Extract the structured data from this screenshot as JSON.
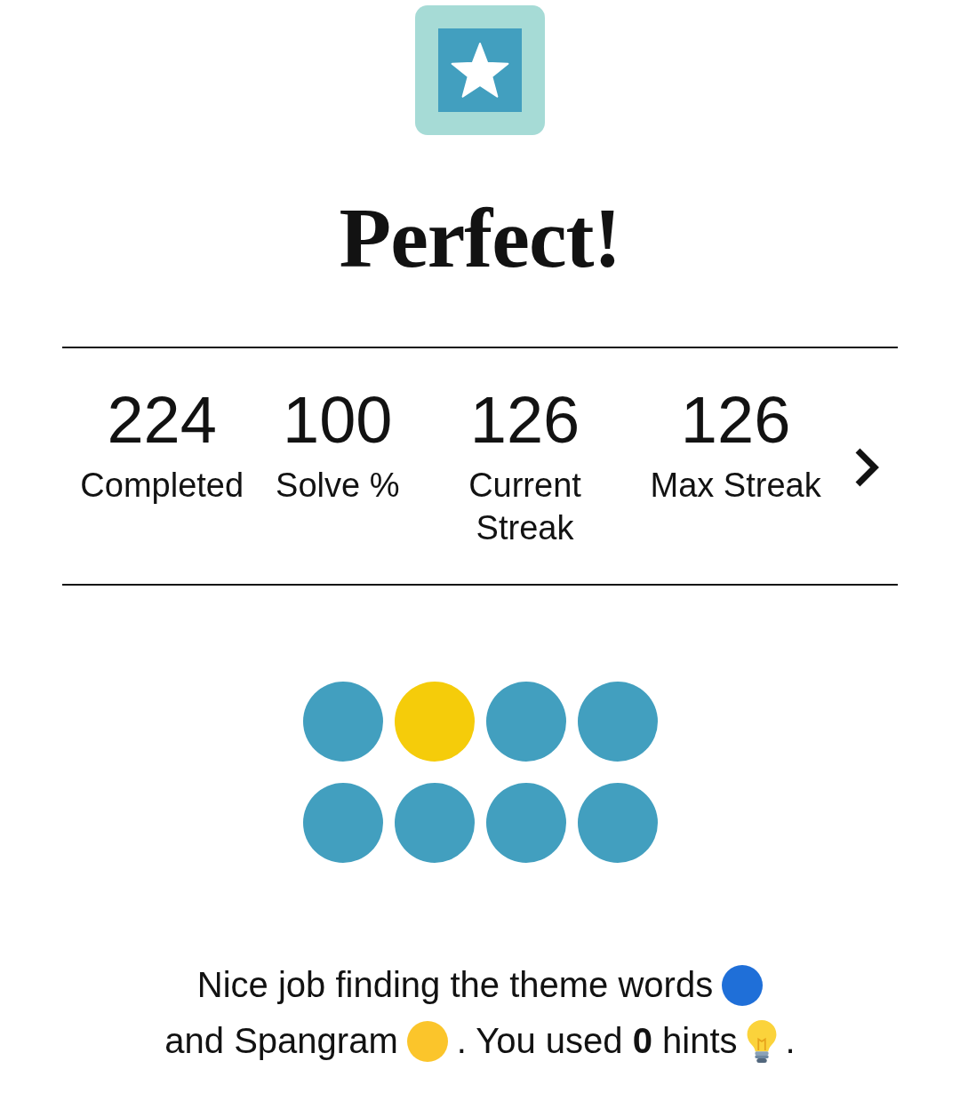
{
  "title": "Perfect!",
  "stats": [
    {
      "value": "224",
      "label": "Completed"
    },
    {
      "value": "100",
      "label": "Solve %"
    },
    {
      "value": "126",
      "label": "Current Streak"
    },
    {
      "value": "126",
      "label": "Max Streak"
    }
  ],
  "dots": [
    {
      "color": "#429fbf"
    },
    {
      "color": "#f5cc0a"
    },
    {
      "color": "#429fbf"
    },
    {
      "color": "#429fbf"
    },
    {
      "color": "#429fbf"
    },
    {
      "color": "#429fbf"
    },
    {
      "color": "#429fbf"
    },
    {
      "color": "#429fbf"
    }
  ],
  "message": [
    {
      "kind": "text",
      "text": "Nice job finding the theme words"
    },
    {
      "kind": "dot",
      "color": "#1f6fd8"
    },
    {
      "kind": "text",
      "text": "and Spangram"
    },
    {
      "kind": "dot",
      "color": "#fbc52b"
    },
    {
      "kind": "text",
      "text": ". You used **0** hints"
    },
    {
      "kind": "bulb"
    },
    {
      "kind": "text",
      "text": "."
    }
  ]
}
